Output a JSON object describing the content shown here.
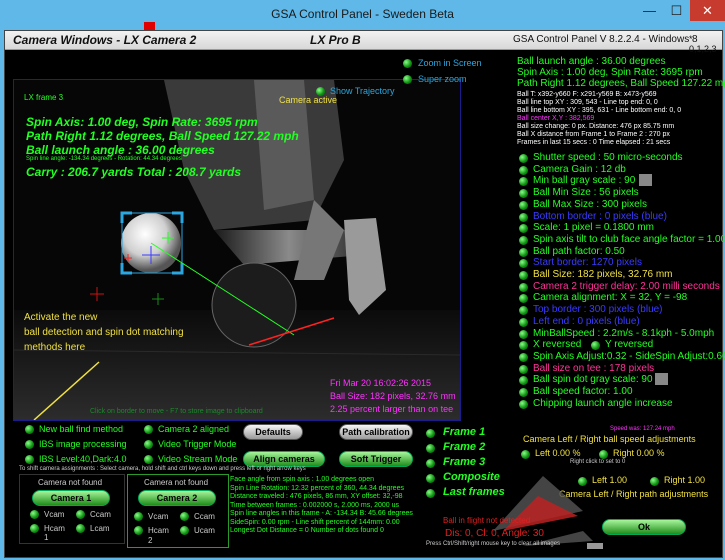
{
  "window": {
    "title": "GSA Control Panel - Sweden Beta",
    "min_glyph": "—",
    "max_glyph": "☐",
    "close_glyph": "✕"
  },
  "header": {
    "left": "Camera Windows - LX Camera 2",
    "center": "LX Pro B",
    "right": "GSA Control Panel V 8.2.2.4 - Windows 8",
    "far_right": "* 0,1,2,3"
  },
  "camera": {
    "frame_label": "LX frame 3",
    "status": "Camera active",
    "zoom_in": "Zoom in Screen",
    "super_zoom": "Super zoom",
    "show_trajectory": "Show Trajectory",
    "stats": [
      "Spin Axis: 1.00 deg, Spin Rate: 3695 rpm",
      "Path Right 1.12 degrees, Ball Speed 127.22 mph",
      "Ball launch angle : 36.00 degrees"
    ],
    "spin_line": "Spin line angle: -134.34 degrees - Rotation: 44.34 degrees",
    "carry": "Carry : 206.7 yards  Total : 208.7 yards",
    "annotation": [
      "Activate the new",
      "ball detection and spin dot matching",
      "methods here"
    ],
    "timestamp": "Fri Mar 20 16:02:26 2015",
    "ball_size": "Ball Size: 182 pixels, 32.76 mm",
    "percent": "2.25 percent larger than on tee",
    "hint": "Click on border to move - F7 to store image to clipboard"
  },
  "controls": {
    "checks": [
      {
        "label": "New ball find method"
      },
      {
        "label": "IBS image processing"
      },
      {
        "label": "IBS Level:40,Dark:4.0"
      }
    ],
    "checks2": [
      {
        "label": "Camera 2 aligned"
      },
      {
        "label": "Video Trigger Mode"
      },
      {
        "label": "Video Stream Mode"
      }
    ],
    "buttons": {
      "defaults": "Defaults",
      "path_cal": "Path calibration",
      "align": "Align cameras",
      "soft_trigger": "Soft Trigger"
    },
    "frames": [
      "Frame 1",
      "Frame 2",
      "Frame 3",
      "Composite",
      "Last frames"
    ],
    "shift_hint": "To shift camera assignments : Select camera, hold shift and ctrl keys down and press left or right arrow keys",
    "cam1": {
      "status": "Camera not found",
      "button": "Camera 1",
      "vcam": "Vcam",
      "ccam": "Ccam",
      "hcam": "Hcam",
      "lcam": "Lcam",
      "num": "1"
    },
    "cam2": {
      "status": "Camera not found",
      "button": "Camera 2",
      "vcam": "Vcam",
      "ccam": "Ccam",
      "hcam": "Hcam",
      "ucam": "Ucam",
      "num": "2"
    },
    "info": [
      "Face angle from spin axis : 1.00 degrees open",
      "Spin Line Rotation: 12.32 percent of 360, 44.34 degrees",
      "Distance traveled : 476 pixels, 86 mm, XY offset: 32,-98",
      "Time between frames : 0.002000 s, 2.000 ms, 2000 us",
      "Spin line angles in this frame - A: -134.34  B: 45.66 degrees",
      "SideSpin: 0.00 rpm - Line shift percent of 144mm: 0.00",
      "Longest Dot Distance = 0 Number of dots found 0"
    ]
  },
  "right": {
    "top": [
      "Ball launch angle : 36.00 degrees",
      "Spin Axis : 1.00 deg, Spin Rate: 3695 rpm",
      "Path Right 1.12 degrees, Ball Speed 127.22 mph"
    ],
    "small": [
      "Ball T: x392-y660 F: x291-y569 B: x473-y569",
      "Ball line top XY : 309, 543 - Line top end: 0, 0",
      "Ball line bottom XY : 395, 631 - Line bottom end: 0, 0"
    ],
    "center": "Ball center X,Y : 382,569",
    "small2": [
      "Ball size change: 0 px. Distance: 476 px 85.75 mm",
      "Ball X distance from Frame 1 to Frame 2 : 270 px",
      "Frames in last 15 secs : 0 Time elapsed : 21 secs"
    ],
    "items": [
      {
        "t": "Shutter speed : 50 micro-seconds",
        "c": "#22ff22"
      },
      {
        "t": "Camera Gain : 12 db",
        "c": "#22ff22"
      },
      {
        "t": "Min ball gray scale : 90",
        "c": "#22ff22"
      },
      {
        "t": "Ball Min Size : 56 pixels",
        "c": "#22ff22"
      },
      {
        "t": "Ball Max Size : 300 pixels",
        "c": "#22ff22"
      },
      {
        "t": "Bottom border : 0 pixels (blue)",
        "c": "#3a3aff"
      },
      {
        "t": "Scale: 1 pixel = 0.1800 mm",
        "c": "#22ff22"
      },
      {
        "t": "Spin axis tilt to club face angle factor = 1.00",
        "c": "#22ff22"
      },
      {
        "t": "Ball path factor: 0.50",
        "c": "#22ff22"
      },
      {
        "t": "Start border: 1270 pixels",
        "c": "#3a3aff"
      },
      {
        "t": "Ball Size: 182 pixels, 32.76 mm",
        "c": "#f0e040"
      },
      {
        "t": "Camera 2 trigger delay: 2.00 milli seconds",
        "c": "#ff3399"
      },
      {
        "t": "Camera alignment: X = 32, Y = -98",
        "c": "#22ff22"
      },
      {
        "t": "Top border : 300 pixels (blue)",
        "c": "#3a3aff"
      },
      {
        "t": "Left end : 0 pixels (blue)",
        "c": "#3a3aff"
      },
      {
        "t": "MinBallSpeed : 2.2m/s - 8.1kph - 5.0mph",
        "c": "#22ff22"
      },
      {
        "t": "X reversed",
        "c": "#22ff22",
        "t2": "Y reversed"
      },
      {
        "t": "Spin Axis Adjust:0.32 - SideSpin Adjust:0.66",
        "c": "#22ff22"
      },
      {
        "t": "Ball size on tee : 178 pixels",
        "c": "#ff3399"
      },
      {
        "t": "Ball spin dot gray scale: 90",
        "c": "#22ff22"
      },
      {
        "t": "Ball speed factor: 1.00",
        "c": "#22ff22"
      },
      {
        "t": "Chipping launch angle increase",
        "c": "#22ff22"
      }
    ],
    "speed_was": "Speed was: 127.24 mph",
    "lr_speed": "Camera Left / Right ball speed adjustments",
    "left_pct": "Left  0.00 %",
    "right_pct": "Right  0.00 %",
    "rightclick": "Right click to set to 0",
    "left_val": "Left  1.00",
    "right_val": "Right  1.00",
    "lr_path": "Camera Left / Right path adjustments",
    "not_detected": "Ball in flight not detected",
    "dis": "Dis: 0, Cl: 0, Angle: 30",
    "ctrl_hint": "Press Ctrl/Shift/right mouse key to clear all images",
    "ok": "Ok"
  }
}
